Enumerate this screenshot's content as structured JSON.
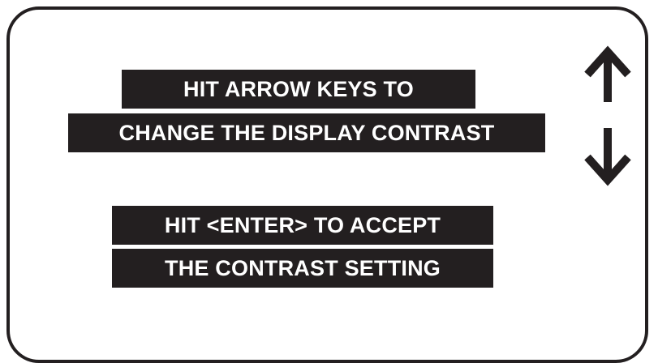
{
  "instructions": {
    "line1": "HIT ARROW KEYS TO",
    "line2": "CHANGE THE DISPLAY CONTRAST",
    "line3": "HIT <ENTER> TO ACCEPT",
    "line4": "THE CONTRAST SETTING"
  },
  "icons": {
    "up": "arrow-up-icon",
    "down": "arrow-down-icon"
  },
  "colors": {
    "ink": "#231f20",
    "background": "#ffffff"
  }
}
